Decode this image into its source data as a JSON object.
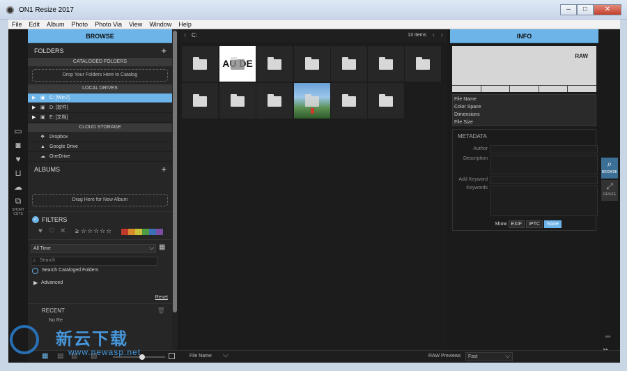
{
  "window": {
    "title": "ON1 Resize 2017",
    "min": "–",
    "max": "□",
    "close": "✕"
  },
  "menu": [
    "File",
    "Edit",
    "Album",
    "Photo",
    "Photo Via",
    "View",
    "Window",
    "Help"
  ],
  "browse": {
    "header": "BROWSE",
    "folders": {
      "title": "FOLDERS",
      "cataloged_header": "CATALOGED FOLDERS",
      "drop_hint": "Drop Your Folders Here to Catalog"
    },
    "local_drives": {
      "header": "LOCAL DRIVES",
      "items": [
        "C: [Win7]",
        "D: [软件]",
        "E: [文档]"
      ]
    },
    "cloud": {
      "header": "CLOUD STORAGE",
      "items": [
        "Dropbox",
        "Google Drive",
        "OneDrive"
      ]
    },
    "albums": {
      "title": "ALBUMS",
      "drop_hint": "Drag Here for New Album"
    },
    "filters": {
      "title": "FILTERS",
      "rating_prefix": "≥",
      "stars": "☆☆☆☆☆",
      "time": "All Time",
      "search_placeholder": "Search",
      "search_cataloged": "Search Cataloged Folders",
      "advanced": "Advanced",
      "reset": "Reset"
    },
    "recent": {
      "title": "RECENT",
      "partial": "No Re"
    }
  },
  "tools": {
    "shortcuts_label": "SHORT CUTS"
  },
  "center": {
    "path": "C:",
    "count": "13 Items",
    "thumb_text": "AU DE"
  },
  "info": {
    "header": "INFO",
    "raw_label": "RAW",
    "file_fields": [
      "File Name",
      "Color Space",
      "Dimensions",
      "File Size"
    ],
    "metadata": {
      "title": "METADATA",
      "author": "Author",
      "description": "Description",
      "add_keyword": "Add Keyword",
      "keywords": "Keywords",
      "show": "Show",
      "buttons": [
        "EXIF",
        "IPTC",
        "None"
      ]
    }
  },
  "modes": {
    "browse": "BROWSE",
    "resize": "RESIZE"
  },
  "bottom": {
    "sort": "File Name",
    "raw_previews": "RAW Previews",
    "raw_mode": "Fast"
  },
  "watermark": {
    "text": "新云下载",
    "url": "www.newasp.net"
  },
  "colors": {
    "accent": "#6db4e8",
    "label_colors": [
      "#c0392b",
      "#d68a2c",
      "#c9c13a",
      "#4f9a45",
      "#3d6fb6",
      "#7b4ea3"
    ]
  }
}
